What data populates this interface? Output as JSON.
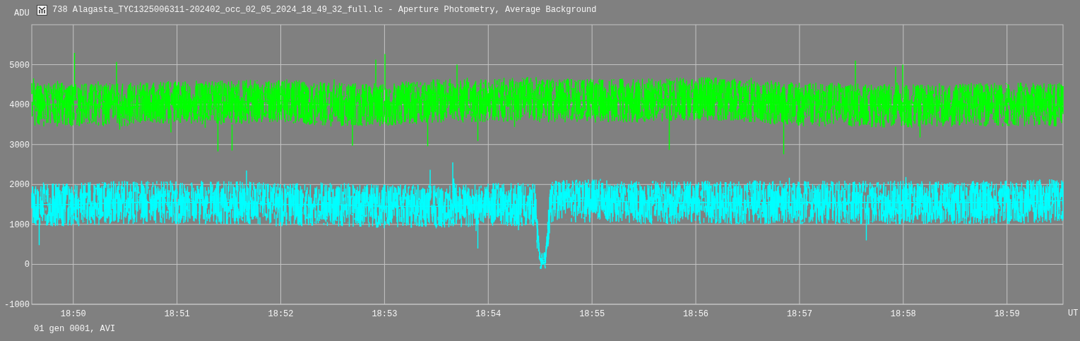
{
  "window": {
    "title": "738 Alagasta_TYC1325006311-202402_occ_02_05_2024_18_49_32_full.lc - Aperture Photometry, Average Background"
  },
  "chart": {
    "chart_data": {
      "type": "line",
      "grid": true,
      "ylabel": "ADU",
      "xlabel": "UT",
      "xlim": [
        1129.6,
        1139.54
      ],
      "ylim": [
        -1000,
        6000
      ],
      "yticks": [
        -1000,
        0,
        1000,
        2000,
        3000,
        4000,
        5000
      ],
      "xticks": [
        {
          "value": 1130,
          "label": "18:50"
        },
        {
          "value": 1131,
          "label": "18:51"
        },
        {
          "value": 1132,
          "label": "18:52"
        },
        {
          "value": 1133,
          "label": "18:53"
        },
        {
          "value": 1134,
          "label": "18:54"
        },
        {
          "value": 1135,
          "label": "18:55"
        },
        {
          "value": 1136,
          "label": "18:56"
        },
        {
          "value": 1137,
          "label": "18:57"
        },
        {
          "value": 1138,
          "label": "18:58"
        },
        {
          "value": 1139,
          "label": "18:59"
        }
      ],
      "x": [
        1129.6,
        1130,
        1130.5,
        1131,
        1131.5,
        1132,
        1132.5,
        1133,
        1133.5,
        1134,
        1134.4,
        1134.45,
        1134.5,
        1134.55,
        1134.6,
        1134.65,
        1135,
        1135.5,
        1136,
        1136.5,
        1137,
        1137.5,
        1138,
        1138.5,
        1139,
        1139.54
      ],
      "series": [
        {
          "color": "#00ff00",
          "values": [
            4000,
            4000,
            4000,
            4050,
            4050,
            4100,
            4000,
            4000,
            4100,
            4100,
            4150,
            4150,
            4100,
            4100,
            4100,
            4100,
            4100,
            4100,
            4150,
            4100,
            4000,
            4000,
            3950,
            4000,
            4000,
            4000
          ]
        },
        {
          "color": "#00ffff",
          "values": [
            1500,
            1500,
            1550,
            1550,
            1550,
            1500,
            1500,
            1450,
            1450,
            1500,
            1500,
            1500,
            100,
            100,
            1550,
            1550,
            1600,
            1550,
            1550,
            1550,
            1550,
            1550,
            1550,
            1550,
            1550,
            1600
          ]
        }
      ]
    }
  },
  "footer": {
    "text": "01 gen 0001, AVI"
  }
}
